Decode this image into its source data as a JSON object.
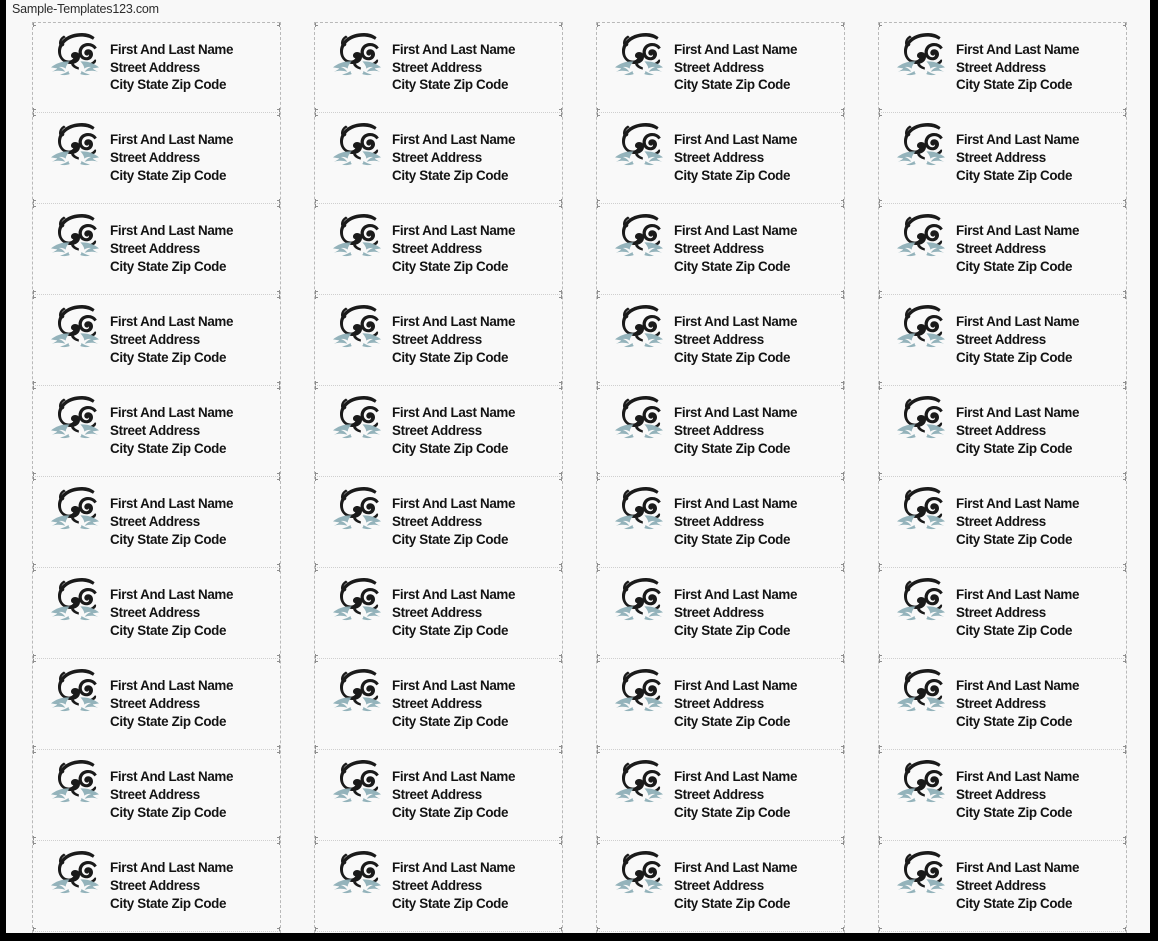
{
  "page": {
    "watermark": "Sample-Templates123.com",
    "background_color": "#f8f8f8",
    "border_color": "#000000",
    "label_background_color": "#f9f9f9",
    "cut_line_color": "#b9b9b9"
  },
  "label": {
    "ornament_name": "decorative-flourish-ornament",
    "ornament_dark_color": "#1a1a1a",
    "ornament_accent_color": "#8fb0b8",
    "text_color": "#131313",
    "lines": [
      "First And Last Name",
      "Street Address",
      "City State Zip Code"
    ]
  },
  "grid": {
    "columns": 4,
    "rows": 10,
    "column_count_label": "4",
    "row_count_label": "10",
    "total_labels": 40
  },
  "labels": [
    {
      "id": 1,
      "row": 1,
      "column": 1,
      "name": "First And Last Name",
      "street": "Street Address",
      "city": "City State Zip Code"
    },
    {
      "id": 2,
      "row": 1,
      "column": 2,
      "name": "First And Last Name",
      "street": "Street Address",
      "city": "City State Zip Code"
    },
    {
      "id": 3,
      "row": 1,
      "column": 3,
      "name": "First And Last Name",
      "street": "Street Address",
      "city": "City State Zip Code"
    },
    {
      "id": 4,
      "row": 1,
      "column": 4,
      "name": "First And Last Name",
      "street": "Street Address",
      "city": "City State Zip Code"
    },
    {
      "id": 5,
      "row": 2,
      "column": 1,
      "name": "First And Last Name",
      "street": "Street Address",
      "city": "City State Zip Code"
    },
    {
      "id": 6,
      "row": 2,
      "column": 2,
      "name": "First And Last Name",
      "street": "Street Address",
      "city": "City State Zip Code"
    },
    {
      "id": 7,
      "row": 2,
      "column": 3,
      "name": "First And Last Name",
      "street": "Street Address",
      "city": "City State Zip Code"
    },
    {
      "id": 8,
      "row": 2,
      "column": 4,
      "name": "First And Last Name",
      "street": "Street Address",
      "city": "City State Zip Code"
    },
    {
      "id": 9,
      "row": 3,
      "column": 1,
      "name": "First And Last Name",
      "street": "Street Address",
      "city": "City State Zip Code"
    },
    {
      "id": 10,
      "row": 3,
      "column": 2,
      "name": "First And Last Name",
      "street": "Street Address",
      "city": "City State Zip Code"
    },
    {
      "id": 11,
      "row": 3,
      "column": 3,
      "name": "First And Last Name",
      "street": "Street Address",
      "city": "City State Zip Code"
    },
    {
      "id": 12,
      "row": 3,
      "column": 4,
      "name": "First And Last Name",
      "street": "Street Address",
      "city": "City State Zip Code"
    },
    {
      "id": 13,
      "row": 4,
      "column": 1,
      "name": "First And Last Name",
      "street": "Street Address",
      "city": "City State Zip Code"
    },
    {
      "id": 14,
      "row": 4,
      "column": 2,
      "name": "First And Last Name",
      "street": "Street Address",
      "city": "City State Zip Code"
    },
    {
      "id": 15,
      "row": 4,
      "column": 3,
      "name": "First And Last Name",
      "street": "Street Address",
      "city": "City State Zip Code"
    },
    {
      "id": 16,
      "row": 4,
      "column": 4,
      "name": "First And Last Name",
      "street": "Street Address",
      "city": "City State Zip Code"
    },
    {
      "id": 17,
      "row": 5,
      "column": 1,
      "name": "First And Last Name",
      "street": "Street Address",
      "city": "City State Zip Code"
    },
    {
      "id": 18,
      "row": 5,
      "column": 2,
      "name": "First And Last Name",
      "street": "Street Address",
      "city": "City State Zip Code"
    },
    {
      "id": 19,
      "row": 5,
      "column": 3,
      "name": "First And Last Name",
      "street": "Street Address",
      "city": "City State Zip Code"
    },
    {
      "id": 20,
      "row": 5,
      "column": 4,
      "name": "First And Last Name",
      "street": "Street Address",
      "city": "City State Zip Code"
    },
    {
      "id": 21,
      "row": 6,
      "column": 1,
      "name": "First And Last Name",
      "street": "Street Address",
      "city": "City State Zip Code"
    },
    {
      "id": 22,
      "row": 6,
      "column": 2,
      "name": "First And Last Name",
      "street": "Street Address",
      "city": "City State Zip Code"
    },
    {
      "id": 23,
      "row": 6,
      "column": 3,
      "name": "First And Last Name",
      "street": "Street Address",
      "city": "City State Zip Code"
    },
    {
      "id": 24,
      "row": 6,
      "column": 4,
      "name": "First And Last Name",
      "street": "Street Address",
      "city": "City State Zip Code"
    },
    {
      "id": 25,
      "row": 7,
      "column": 1,
      "name": "First And Last Name",
      "street": "Street Address",
      "city": "City State Zip Code"
    },
    {
      "id": 26,
      "row": 7,
      "column": 2,
      "name": "First And Last Name",
      "street": "Street Address",
      "city": "City State Zip Code"
    },
    {
      "id": 27,
      "row": 7,
      "column": 3,
      "name": "First And Last Name",
      "street": "Street Address",
      "city": "City State Zip Code"
    },
    {
      "id": 28,
      "row": 7,
      "column": 4,
      "name": "First And Last Name",
      "street": "Street Address",
      "city": "City State Zip Code"
    },
    {
      "id": 29,
      "row": 8,
      "column": 1,
      "name": "First And Last Name",
      "street": "Street Address",
      "city": "City State Zip Code"
    },
    {
      "id": 30,
      "row": 8,
      "column": 2,
      "name": "First And Last Name",
      "street": "Street Address",
      "city": "City State Zip Code"
    },
    {
      "id": 31,
      "row": 8,
      "column": 3,
      "name": "First And Last Name",
      "street": "Street Address",
      "city": "City State Zip Code"
    },
    {
      "id": 32,
      "row": 8,
      "column": 4,
      "name": "First And Last Name",
      "street": "Street Address",
      "city": "City State Zip Code"
    },
    {
      "id": 33,
      "row": 9,
      "column": 1,
      "name": "First And Last Name",
      "street": "Street Address",
      "city": "City State Zip Code"
    },
    {
      "id": 34,
      "row": 9,
      "column": 2,
      "name": "First And Last Name",
      "street": "Street Address",
      "city": "City State Zip Code"
    },
    {
      "id": 35,
      "row": 9,
      "column": 3,
      "name": "First And Last Name",
      "street": "Street Address",
      "city": "City State Zip Code"
    },
    {
      "id": 36,
      "row": 9,
      "column": 4,
      "name": "First And Last Name",
      "street": "Street Address",
      "city": "City State Zip Code"
    },
    {
      "id": 37,
      "row": 10,
      "column": 1,
      "name": "First And Last Name",
      "street": "Street Address",
      "city": "City State Zip Code"
    },
    {
      "id": 38,
      "row": 10,
      "column": 2,
      "name": "First And Last Name",
      "street": "Street Address",
      "city": "City State Zip Code"
    },
    {
      "id": 39,
      "row": 10,
      "column": 3,
      "name": "First And Last Name",
      "street": "Street Address",
      "city": "City State Zip Code"
    },
    {
      "id": 40,
      "row": 10,
      "column": 4,
      "name": "First And Last Name",
      "street": "Street Address",
      "city": "City State Zip Code"
    }
  ]
}
